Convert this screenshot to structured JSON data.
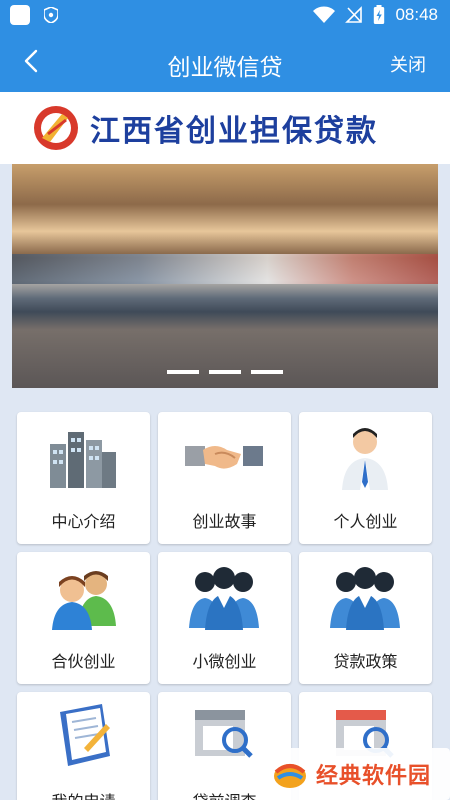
{
  "statusbar": {
    "time": "08:48"
  },
  "header": {
    "title": "创业微信贷",
    "close_label": "关闭"
  },
  "banner": {
    "logo_text": "江西省创业担保贷款"
  },
  "slider": {
    "active_dot": 0,
    "dot_count": 3
  },
  "tiles": [
    {
      "label": "中心介绍",
      "icon": "buildings-icon"
    },
    {
      "label": "创业故事",
      "icon": "handshake-icon"
    },
    {
      "label": "个人创业",
      "icon": "businessman-icon"
    },
    {
      "label": "合伙创业",
      "icon": "partners-icon"
    },
    {
      "label": "小微创业",
      "icon": "team-icon"
    },
    {
      "label": "贷款政策",
      "icon": "group-icon"
    },
    {
      "label": "我的申请",
      "icon": "document-pen-icon"
    },
    {
      "label": "贷前调查",
      "icon": "store-search-icon"
    },
    {
      "label": "",
      "icon": "shop-search-icon"
    }
  ],
  "watermark": {
    "text": "经典软件园"
  },
  "colors": {
    "primary": "#2f8fe3",
    "logo_blue": "#1d3f9e",
    "logo_red": "#d8392b",
    "watermark": "#e8502a"
  }
}
